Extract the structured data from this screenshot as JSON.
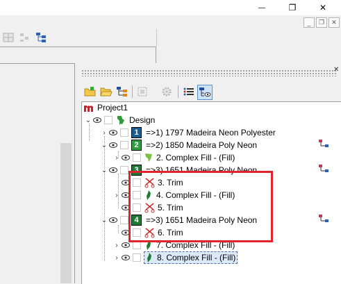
{
  "window": {
    "minimize_label": "—",
    "restore_label": "❐",
    "close_label": "✕"
  },
  "mdi": {
    "minimize_label": "_",
    "restore_label": "❐",
    "close_label": "✕"
  },
  "panel": {
    "close_label": "✕"
  },
  "toolbar": {
    "icons": [
      "new-folder-icon",
      "open-folder-icon",
      "tree-structure-icon",
      "group-icon",
      "settings-icon",
      "list-view-icon",
      "visibility-view-icon"
    ]
  },
  "tree": {
    "project_label": "Project1",
    "design_label": "Design",
    "rows": [
      {
        "num": "1",
        "label": "=>1) 1797 Madeira Neon Polyester",
        "color": "#1c5d8f"
      },
      {
        "num": "2",
        "label": "=>2) 1850 Madeira Poly Neon",
        "color": "#2ea043"
      },
      {
        "label": "2. Complex Fill - (Fill)"
      },
      {
        "num": "3",
        "label": "=>3) 1651 Madeira Poly Neon",
        "color": "#1e7a35"
      },
      {
        "label": "3. Trim"
      },
      {
        "label": "4. Complex Fill - (Fill)"
      },
      {
        "label": "5. Trim"
      },
      {
        "num": "4",
        "label": "=>3) 1651 Madeira Poly Neon",
        "color": "#1e7a35"
      },
      {
        "label": "6. Trim"
      },
      {
        "label": "7. Complex Fill - (Fill)"
      },
      {
        "label": "8. Complex Fill - (Fill)"
      }
    ]
  },
  "colors": {
    "highlight_box": "#e0242e",
    "selection": "#dce9f8"
  }
}
